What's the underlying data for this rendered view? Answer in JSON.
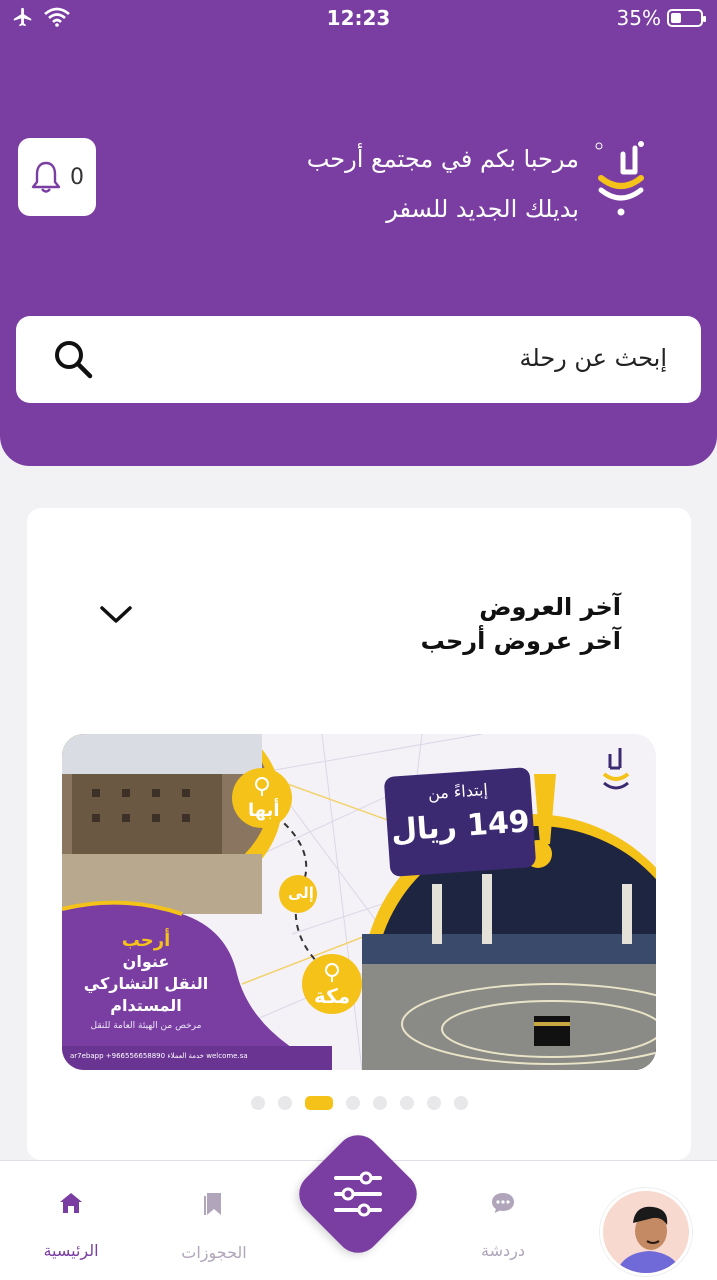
{
  "status_bar": {
    "time": "12:23",
    "battery": "35%",
    "battery_level": 0.35
  },
  "header": {
    "welcome_line1": "مرحبا بكم في مجتمع أرحب",
    "welcome_line2": "بديلك الجديد للسفر",
    "notification_count": "0"
  },
  "search": {
    "placeholder": "إبحث عن رحلة"
  },
  "offers": {
    "title": "آخر العروض",
    "subtitle": "آخر عروض أرحب",
    "banner": {
      "from_label": "إبتداءً من",
      "price": "149 ريال",
      "city_from": "أبها",
      "to_label": "إلى",
      "city_to": "مكة",
      "brand": "أرحب",
      "tagline_1": "عنوان",
      "tagline_2": "النقل التشاركي",
      "tagline_3": "المستدام",
      "licensed": "مرخص من الهيئة العامة للنقل",
      "contact": "ar7ebapp   +966556658890  خدمة العملاء   welcome.sa"
    },
    "pagination": {
      "count": 8,
      "active_index": 2
    }
  },
  "bottom_nav": {
    "home": "الرئيسية",
    "bookings": "الحجوزات",
    "chat": "دردشة"
  },
  "colors": {
    "primary": "#7a3ea3",
    "accent": "#f5c21a",
    "dark": "#3b2a72"
  },
  "icons": [
    "airplane-icon",
    "wifi-icon",
    "bell-icon",
    "search-icon",
    "chevron-down-icon",
    "home-icon",
    "bookmark-icon",
    "chat-icon",
    "filter-sliders-icon"
  ]
}
